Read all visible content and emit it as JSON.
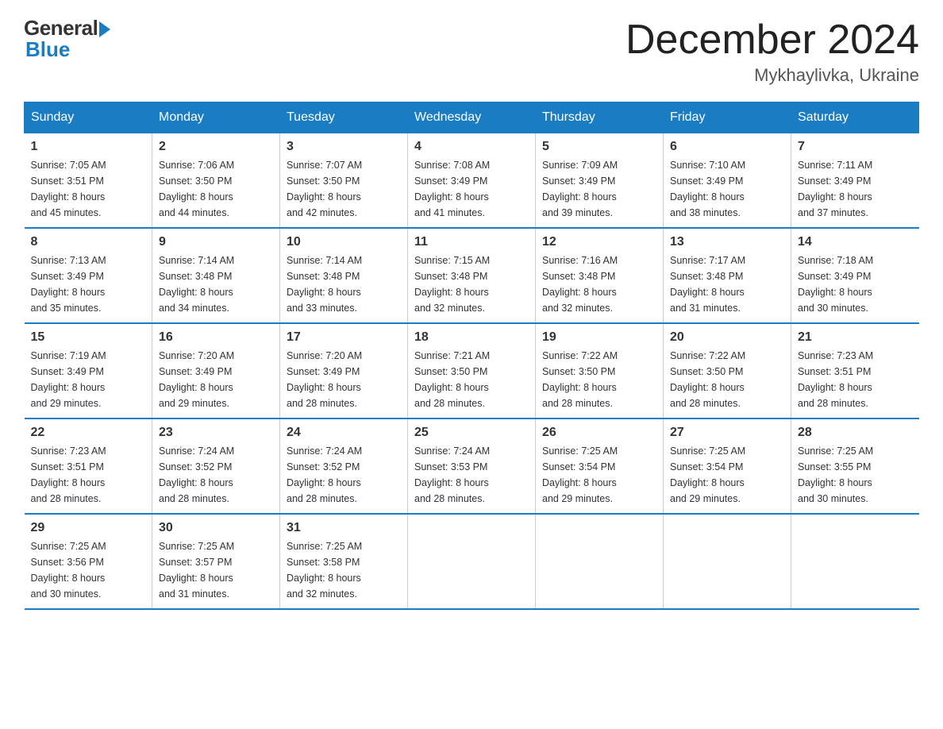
{
  "logo": {
    "general": "General",
    "blue": "Blue"
  },
  "header": {
    "month": "December 2024",
    "location": "Mykhaylivka, Ukraine"
  },
  "weekdays": [
    "Sunday",
    "Monday",
    "Tuesday",
    "Wednesday",
    "Thursday",
    "Friday",
    "Saturday"
  ],
  "weeks": [
    [
      {
        "day": "1",
        "sunrise": "7:05 AM",
        "sunset": "3:51 PM",
        "daylight": "8 hours and 45 minutes."
      },
      {
        "day": "2",
        "sunrise": "7:06 AM",
        "sunset": "3:50 PM",
        "daylight": "8 hours and 44 minutes."
      },
      {
        "day": "3",
        "sunrise": "7:07 AM",
        "sunset": "3:50 PM",
        "daylight": "8 hours and 42 minutes."
      },
      {
        "day": "4",
        "sunrise": "7:08 AM",
        "sunset": "3:49 PM",
        "daylight": "8 hours and 41 minutes."
      },
      {
        "day": "5",
        "sunrise": "7:09 AM",
        "sunset": "3:49 PM",
        "daylight": "8 hours and 39 minutes."
      },
      {
        "day": "6",
        "sunrise": "7:10 AM",
        "sunset": "3:49 PM",
        "daylight": "8 hours and 38 minutes."
      },
      {
        "day": "7",
        "sunrise": "7:11 AM",
        "sunset": "3:49 PM",
        "daylight": "8 hours and 37 minutes."
      }
    ],
    [
      {
        "day": "8",
        "sunrise": "7:13 AM",
        "sunset": "3:49 PM",
        "daylight": "8 hours and 35 minutes."
      },
      {
        "day": "9",
        "sunrise": "7:14 AM",
        "sunset": "3:48 PM",
        "daylight": "8 hours and 34 minutes."
      },
      {
        "day": "10",
        "sunrise": "7:14 AM",
        "sunset": "3:48 PM",
        "daylight": "8 hours and 33 minutes."
      },
      {
        "day": "11",
        "sunrise": "7:15 AM",
        "sunset": "3:48 PM",
        "daylight": "8 hours and 32 minutes."
      },
      {
        "day": "12",
        "sunrise": "7:16 AM",
        "sunset": "3:48 PM",
        "daylight": "8 hours and 32 minutes."
      },
      {
        "day": "13",
        "sunrise": "7:17 AM",
        "sunset": "3:48 PM",
        "daylight": "8 hours and 31 minutes."
      },
      {
        "day": "14",
        "sunrise": "7:18 AM",
        "sunset": "3:49 PM",
        "daylight": "8 hours and 30 minutes."
      }
    ],
    [
      {
        "day": "15",
        "sunrise": "7:19 AM",
        "sunset": "3:49 PM",
        "daylight": "8 hours and 29 minutes."
      },
      {
        "day": "16",
        "sunrise": "7:20 AM",
        "sunset": "3:49 PM",
        "daylight": "8 hours and 29 minutes."
      },
      {
        "day": "17",
        "sunrise": "7:20 AM",
        "sunset": "3:49 PM",
        "daylight": "8 hours and 28 minutes."
      },
      {
        "day": "18",
        "sunrise": "7:21 AM",
        "sunset": "3:50 PM",
        "daylight": "8 hours and 28 minutes."
      },
      {
        "day": "19",
        "sunrise": "7:22 AM",
        "sunset": "3:50 PM",
        "daylight": "8 hours and 28 minutes."
      },
      {
        "day": "20",
        "sunrise": "7:22 AM",
        "sunset": "3:50 PM",
        "daylight": "8 hours and 28 minutes."
      },
      {
        "day": "21",
        "sunrise": "7:23 AM",
        "sunset": "3:51 PM",
        "daylight": "8 hours and 28 minutes."
      }
    ],
    [
      {
        "day": "22",
        "sunrise": "7:23 AM",
        "sunset": "3:51 PM",
        "daylight": "8 hours and 28 minutes."
      },
      {
        "day": "23",
        "sunrise": "7:24 AM",
        "sunset": "3:52 PM",
        "daylight": "8 hours and 28 minutes."
      },
      {
        "day": "24",
        "sunrise": "7:24 AM",
        "sunset": "3:52 PM",
        "daylight": "8 hours and 28 minutes."
      },
      {
        "day": "25",
        "sunrise": "7:24 AM",
        "sunset": "3:53 PM",
        "daylight": "8 hours and 28 minutes."
      },
      {
        "day": "26",
        "sunrise": "7:25 AM",
        "sunset": "3:54 PM",
        "daylight": "8 hours and 29 minutes."
      },
      {
        "day": "27",
        "sunrise": "7:25 AM",
        "sunset": "3:54 PM",
        "daylight": "8 hours and 29 minutes."
      },
      {
        "day": "28",
        "sunrise": "7:25 AM",
        "sunset": "3:55 PM",
        "daylight": "8 hours and 30 minutes."
      }
    ],
    [
      {
        "day": "29",
        "sunrise": "7:25 AM",
        "sunset": "3:56 PM",
        "daylight": "8 hours and 30 minutes."
      },
      {
        "day": "30",
        "sunrise": "7:25 AM",
        "sunset": "3:57 PM",
        "daylight": "8 hours and 31 minutes."
      },
      {
        "day": "31",
        "sunrise": "7:25 AM",
        "sunset": "3:58 PM",
        "daylight": "8 hours and 32 minutes."
      },
      null,
      null,
      null,
      null
    ]
  ],
  "labels": {
    "sunrise": "Sunrise: ",
    "sunset": "Sunset: ",
    "daylight": "Daylight: "
  }
}
